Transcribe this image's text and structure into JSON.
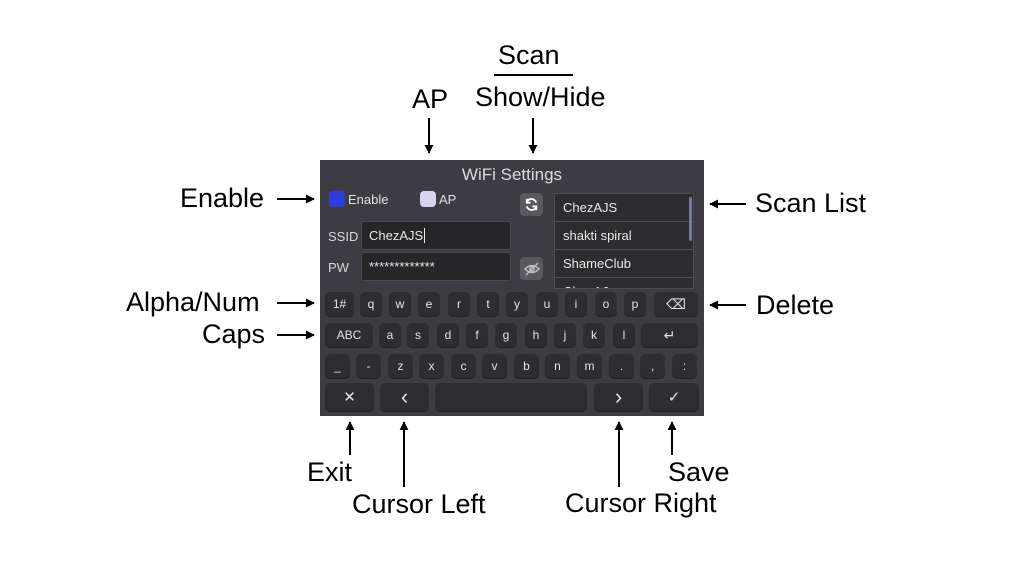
{
  "panel": {
    "title": "WiFi Settings",
    "enable_label": "Enable",
    "ap_label": "AP",
    "enable_color": "#2b3fe0",
    "ap_color": "#d9d2f0",
    "ssid_label": "SSID",
    "ssid_value": "ChezAJS",
    "pw_label": "PW",
    "pw_value": "*************",
    "scan_list": [
      "ChezAJS",
      "shakti spiral",
      "ShameClub",
      "ChezAJ..."
    ]
  },
  "keyboard": {
    "row1": [
      "1#",
      "q",
      "w",
      "e",
      "r",
      "t",
      "y",
      "u",
      "i",
      "o",
      "p"
    ],
    "row2": [
      "ABC",
      "a",
      "s",
      "d",
      "f",
      "g",
      "h",
      "j",
      "k",
      "l"
    ],
    "row3": [
      "_",
      "-",
      "z",
      "x",
      "c",
      "v",
      "b",
      "n",
      "m",
      ".",
      ",",
      ":"
    ],
    "exit_symbol": "✕",
    "left_symbol": "‹",
    "right_symbol": "›",
    "save_symbol": "✓",
    "delete_symbol": "⌫",
    "enter_symbol": "↵"
  },
  "annotations": {
    "scan": "Scan",
    "show_hide": "Show/Hide",
    "ap": "AP",
    "enable": "Enable",
    "scan_list": "Scan List",
    "alpha_num": "Alpha/Num",
    "delete": "Delete",
    "caps": "Caps",
    "exit": "Exit",
    "cursor_left": "Cursor Left",
    "cursor_right": "Cursor Right",
    "save": "Save"
  }
}
